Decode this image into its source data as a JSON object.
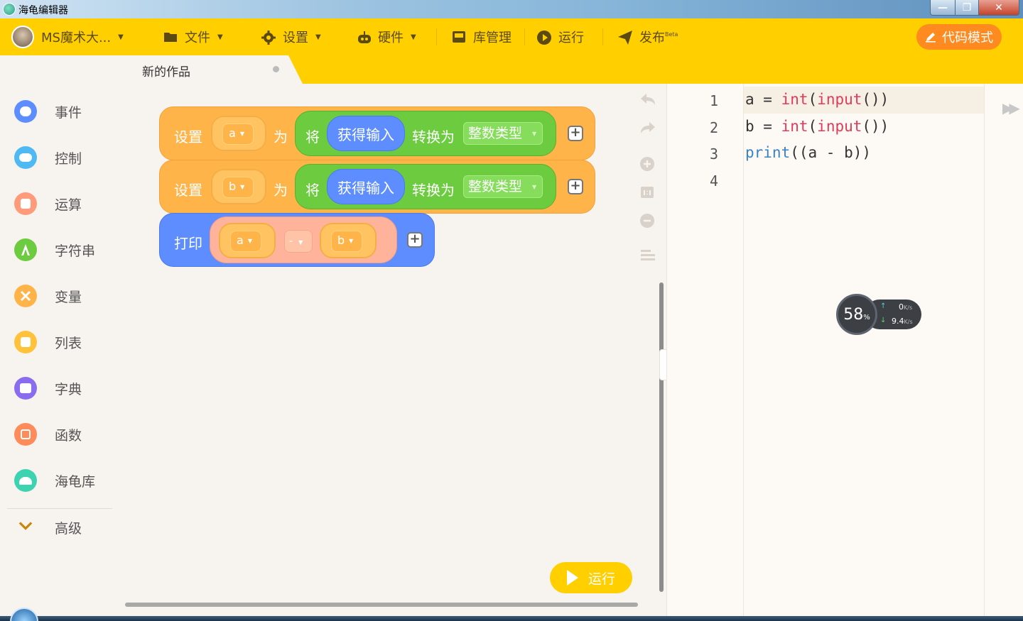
{
  "window": {
    "title": "海龟编辑器",
    "min_label": "—",
    "max_label": "❐",
    "close_label": "✕"
  },
  "menubar": {
    "user": "MS魔术大...",
    "items": [
      {
        "label": "文件",
        "icon": "folder-icon"
      },
      {
        "label": "设置",
        "icon": "gear-icon"
      },
      {
        "label": "硬件",
        "icon": "robot-icon"
      },
      {
        "label": "库管理",
        "icon": "inbox-icon"
      },
      {
        "label": "运行",
        "icon": "play-circle-icon"
      },
      {
        "label": "发布",
        "icon": "paper-plane-icon",
        "badge": "Beta"
      }
    ],
    "code_mode": "代码模式"
  },
  "tab": {
    "label": "新的作品"
  },
  "categories": [
    {
      "label": "事件",
      "color": "#5e8dff"
    },
    {
      "label": "控制",
      "color": "#4fb9f4"
    },
    {
      "label": "运算",
      "color": "#ff9a7a"
    },
    {
      "label": "字符串",
      "color": "#6ccb3f"
    },
    {
      "label": "变量",
      "color": "#ffb44a"
    },
    {
      "label": "列表",
      "color": "#ffc23a"
    },
    {
      "label": "字典",
      "color": "#8a6cf0"
    },
    {
      "label": "函数",
      "color": "#ff8a5a"
    },
    {
      "label": "海龟库",
      "color": "#3dd3b0"
    },
    {
      "label": "高级",
      "color": "#c8860a"
    }
  ],
  "blocks": {
    "set_a": {
      "set": "设置",
      "var": "a",
      "as": "为",
      "jiang": "将",
      "input": "获得输入",
      "convert": "转换为",
      "type": "整数类型"
    },
    "set_b": {
      "set": "设置",
      "var": "b",
      "as": "为",
      "jiang": "将",
      "input": "获得输入",
      "convert": "转换为",
      "type": "整数类型"
    },
    "print": {
      "label": "打印",
      "left": "a",
      "op": "-",
      "right": "b"
    },
    "plus": "+"
  },
  "run_button": "运行",
  "editor": {
    "lines": [
      {
        "num": "1",
        "parts": [
          [
            "a = ",
            ""
          ],
          [
            "int",
            "red"
          ],
          [
            "(",
            ""
          ],
          [
            "input",
            "red"
          ],
          [
            "())",
            ""
          ]
        ]
      },
      {
        "num": "2",
        "parts": [
          [
            "b = ",
            ""
          ],
          [
            "int",
            "red"
          ],
          [
            "(",
            ""
          ],
          [
            "input",
            "red"
          ],
          [
            "())",
            ""
          ]
        ]
      },
      {
        "num": "3",
        "parts": [
          [
            "print",
            "blue"
          ],
          [
            "((a - b))",
            ""
          ]
        ]
      },
      {
        "num": "4",
        "parts": []
      }
    ]
  },
  "net_widget": {
    "percent": "58",
    "percent_unit": "%",
    "up": "0",
    "down": "9.4",
    "unit": "K/s"
  }
}
